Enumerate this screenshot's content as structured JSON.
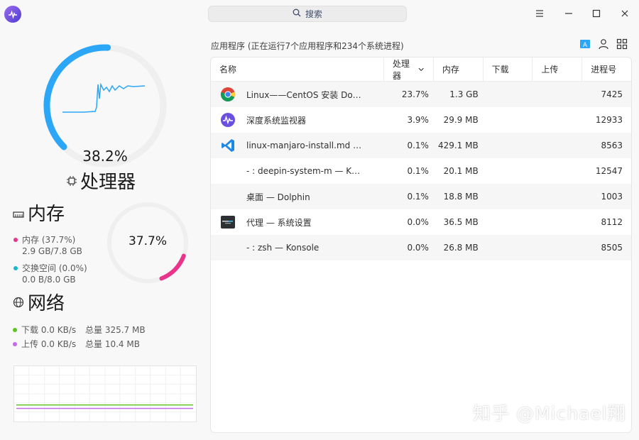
{
  "search": {
    "label": "搜索"
  },
  "cpu": {
    "value": "38.2%",
    "title": "处理器",
    "usage": 0.382
  },
  "memory": {
    "title": "内存",
    "value": "37.7%",
    "usage": 0.377,
    "mem_label": "内存 (37.7%)",
    "mem_detail": "2.9 GB/7.8 GB",
    "swap_label": "交换空间 (0.0%)",
    "swap_detail": "0.0 B/8.0 GB",
    "mem_color": "#e8348a",
    "swap_color": "#1ab6c9"
  },
  "network": {
    "title": "网络",
    "download": {
      "label": "下载 0.0 KB/s",
      "total": "总量 325.7 MB",
      "color": "#5cc320"
    },
    "upload": {
      "label": "上传 0.0 KB/s",
      "total": "总量 10.4 MB",
      "color": "#c46ae8"
    }
  },
  "summary": "应用程序 (正在运行7个应用程序和234个系统进程)",
  "table": {
    "columns": {
      "name": "名称",
      "cpu": "处理器",
      "mem": "内存",
      "download": "下载",
      "upload": "上传",
      "pid": "进程号"
    },
    "rows": [
      {
        "icon": "chrome-icon",
        "name": "Linux——CentOS 安装 Do…",
        "cpu": "23.7%",
        "mem": "1.3 GB",
        "download": "",
        "upload": "",
        "pid": "7425"
      },
      {
        "icon": "deepin-monitor-icon",
        "name": "深度系统监视器",
        "cpu": "3.9%",
        "mem": "29.9 MB",
        "download": "",
        "upload": "",
        "pid": "12933"
      },
      {
        "icon": "vscode-icon",
        "name": "linux-manjaro-install.md …",
        "cpu": "0.1%",
        "mem": "429.1 MB",
        "download": "",
        "upload": "",
        "pid": "8563"
      },
      {
        "icon": "",
        "name": "- : deepin-system-m — K…",
        "cpu": "0.1%",
        "mem": "20.1 MB",
        "download": "",
        "upload": "",
        "pid": "12547"
      },
      {
        "icon": "",
        "name": "桌面 — Dolphin",
        "cpu": "0.1%",
        "mem": "18.8 MB",
        "download": "",
        "upload": "",
        "pid": "1003"
      },
      {
        "icon": "terminal-icon",
        "name": "代理  — 系统设置",
        "cpu": "0.0%",
        "mem": "36.5 MB",
        "download": "",
        "upload": "",
        "pid": "8112"
      },
      {
        "icon": "",
        "name": "- : zsh — Konsole",
        "cpu": "0.0%",
        "mem": "26.8 MB",
        "download": "",
        "upload": "",
        "pid": "8505"
      }
    ]
  },
  "watermark": "知乎 @Michael翔",
  "colors": {
    "cpu_ring": "#2ca7f8",
    "ring_track": "#efefef"
  }
}
